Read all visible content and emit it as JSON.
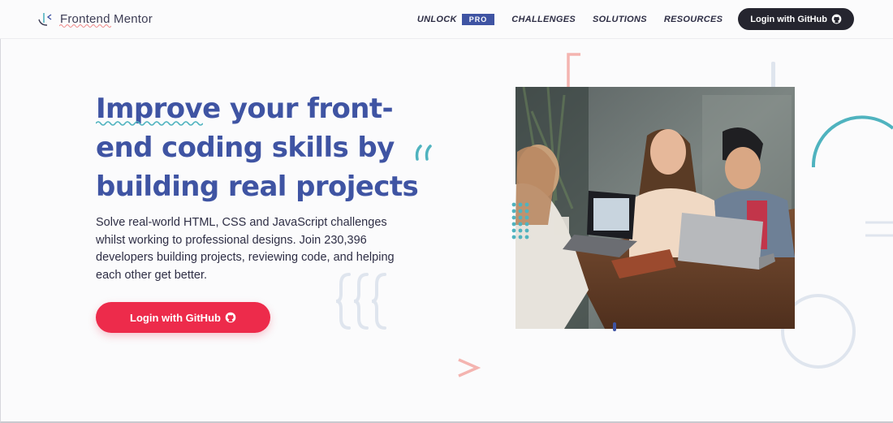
{
  "brand": {
    "name": "Frontend Mentor"
  },
  "nav": {
    "unlock_label": "UNLOCK",
    "pro_badge": "PRO",
    "challenges": "CHALLENGES",
    "solutions": "SOLUTIONS",
    "resources": "RESOURCES",
    "login_label": "Login with GitHub"
  },
  "hero": {
    "title_highlight": "Improve",
    "title_rest": " your front-end coding skills by building real projects",
    "description": "Solve real-world HTML, CSS and JavaScript challenges whilst working to professional designs. Join 230,396 developers building projects, reviewing code, and helping each other get better.",
    "cta_label": "Login with GitHub"
  },
  "colors": {
    "primary": "#3f54a3",
    "accent_red": "#ed2b4b",
    "accent_teal": "#4fb3bf",
    "dark_button": "#25252f",
    "decor_pink": "#f4b4b0",
    "decor_grey": "#dfe5ee"
  },
  "icons": [
    "github-icon",
    "quote-icon",
    "curly-braces-icon",
    "chevron-right-icon",
    "dots-grid-icon"
  ]
}
